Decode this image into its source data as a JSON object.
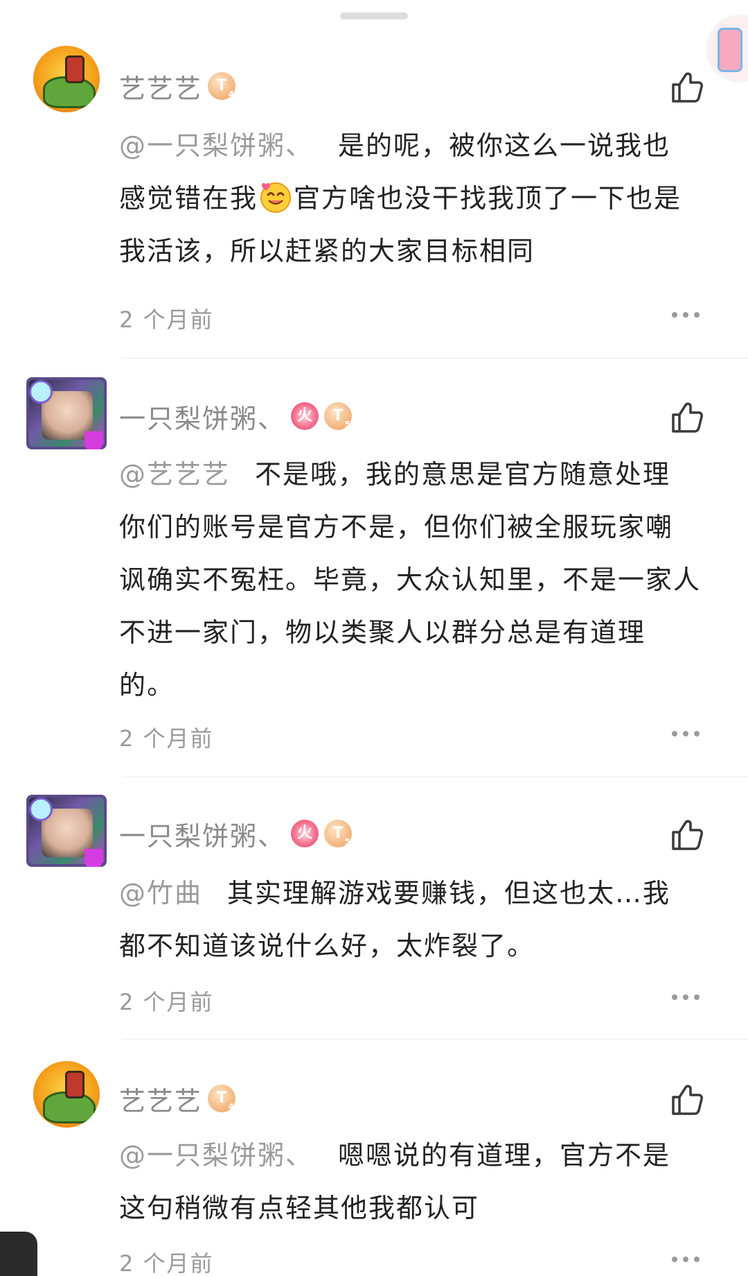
{
  "comments": [
    {
      "username": "艺艺艺",
      "badges": [
        {
          "type": "level",
          "text": "T",
          "sub": "4"
        }
      ],
      "mention": "@一只梨饼粥、",
      "text": "是的呢，被你这么一说我也",
      "text2a": "感觉错在我",
      "emoji": "heart-smile-emoji",
      "text2b": "官方啥也没干找我顶了一下也是",
      "text3": "我活该，所以赶紧的大家目标相同",
      "time": "2 个月前"
    },
    {
      "username": "一只梨饼粥、",
      "badges": [
        {
          "type": "fire",
          "text": "火"
        },
        {
          "type": "level",
          "text": "T",
          "sub": "5"
        }
      ],
      "mention": "@艺艺艺",
      "lines": [
        "不是哦，我的意思是官方随意处理",
        "你们的账号是官方不是，但你们被全服玩家嘲",
        "讽确实不冤枉。毕竟，大众认知里，不是一家人",
        "不进一家门，物以类聚人以群分总是有道理",
        "的。"
      ],
      "time": "2 个月前"
    },
    {
      "username": "一只梨饼粥、",
      "badges": [
        {
          "type": "fire",
          "text": "火"
        },
        {
          "type": "level",
          "text": "T",
          "sub": "5"
        }
      ],
      "mention": "@竹曲",
      "lines": [
        "其实理解游戏要赚钱，但这也太…我",
        "都不知道该说什么好，太炸裂了。"
      ],
      "time": "2 个月前"
    },
    {
      "username": "艺艺艺",
      "badges": [
        {
          "type": "level",
          "text": "T",
          "sub": "4"
        }
      ],
      "mention": "@一只梨饼粥、",
      "lines": [
        "嗯嗯说的有道理，官方不是",
        "这句稍微有点轻其他我都认可"
      ],
      "time": "2 个月前"
    }
  ],
  "icons": {
    "like": "thumbs-up-icon",
    "more": "more-dots-icon"
  },
  "colors": {
    "username": "#8a8a8a",
    "text": "#222222",
    "mention": "#9a9a9a",
    "level_badge": "#f2b27a",
    "fire_badge": "#f46a8a"
  }
}
